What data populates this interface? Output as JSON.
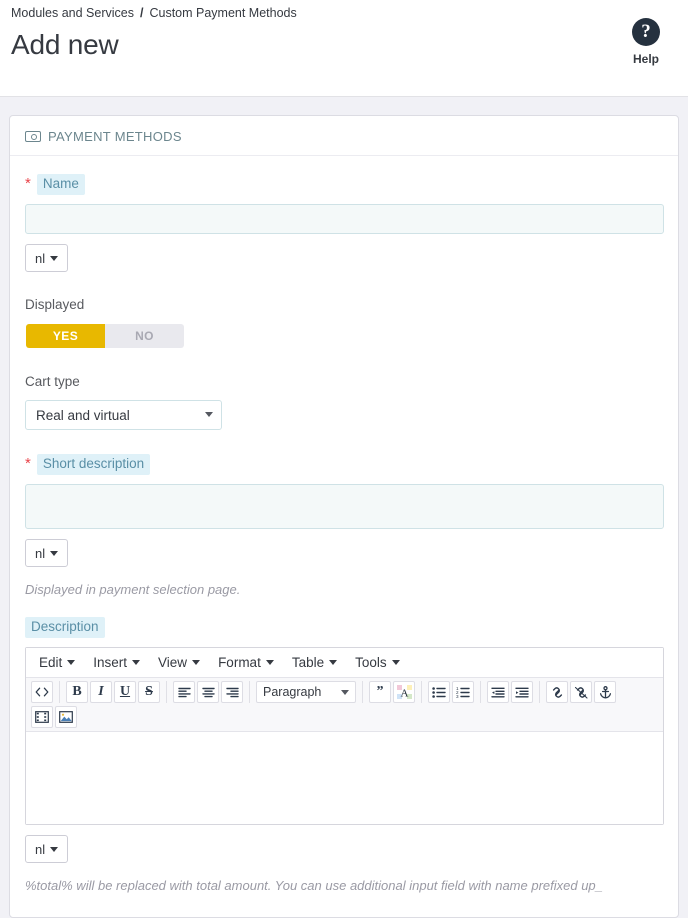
{
  "header": {
    "breadcrumb": [
      {
        "label": "Modules and Services"
      },
      {
        "label": "Custom Payment Methods"
      }
    ],
    "separator": "/",
    "title": "Add new",
    "help_label": "Help",
    "help_icon": "question-circle-icon"
  },
  "panel": {
    "icon": "money-icon",
    "heading": "PAYMENT METHODS"
  },
  "fields": {
    "name": {
      "required_marker": "*",
      "label": "Name",
      "value": "",
      "placeholder": "",
      "lang": "nl"
    },
    "displayed": {
      "label": "Displayed",
      "yes": "YES",
      "no": "NO",
      "selected": "YES"
    },
    "cart_type": {
      "label": "Cart type",
      "selected": "Real and virtual",
      "options": [
        "Real and virtual"
      ]
    },
    "short_description": {
      "required_marker": "*",
      "label": "Short description",
      "value": "",
      "placeholder": "",
      "lang": "nl",
      "hint": "Displayed in payment selection page."
    },
    "description": {
      "label": "Description",
      "value": "",
      "lang": "nl",
      "hint": "%total% will be replaced with total amount. You can use additional input field with name prefixed up_"
    }
  },
  "editor": {
    "menus": [
      {
        "label": "Edit"
      },
      {
        "label": "Insert"
      },
      {
        "label": "View"
      },
      {
        "label": "Format"
      },
      {
        "label": "Table"
      },
      {
        "label": "Tools"
      }
    ],
    "format_select": "Paragraph",
    "buttons_row1_group1": [
      {
        "name": "source-code-icon",
        "glyph": "</>"
      }
    ],
    "buttons_row1_group2": [
      {
        "name": "bold-icon",
        "glyph": "B"
      },
      {
        "name": "italic-icon",
        "glyph": "I"
      },
      {
        "name": "underline-icon",
        "glyph": "U"
      },
      {
        "name": "strikethrough-icon",
        "glyph": "S"
      }
    ],
    "buttons_row1_group3": [
      {
        "name": "align-left-icon",
        "glyph": "align-left"
      },
      {
        "name": "align-center-icon",
        "glyph": "align-center"
      },
      {
        "name": "align-right-icon",
        "glyph": "align-right"
      }
    ],
    "buttons_row1_group5": [
      {
        "name": "blockquote-icon",
        "glyph": "”"
      },
      {
        "name": "text-color-icon",
        "glyph": "A"
      }
    ],
    "buttons_row1_group6": [
      {
        "name": "bullet-list-icon",
        "glyph": "bullets"
      },
      {
        "name": "numbered-list-icon",
        "glyph": "numbers"
      }
    ],
    "buttons_row1_group7": [
      {
        "name": "outdent-icon",
        "glyph": "outdent"
      },
      {
        "name": "indent-icon",
        "glyph": "indent"
      }
    ],
    "buttons_row1_group8": [
      {
        "name": "link-icon",
        "glyph": "link"
      },
      {
        "name": "unlink-icon",
        "glyph": "unlink"
      },
      {
        "name": "anchor-icon",
        "glyph": "anchor"
      }
    ],
    "buttons_row2": [
      {
        "name": "media-icon",
        "glyph": "media"
      },
      {
        "name": "image-icon",
        "glyph": "image"
      }
    ]
  },
  "colors": {
    "accent_yellow": "#e8b800",
    "label_highlight_bg": "#dff1f8",
    "label_highlight_text": "#5a8fa6",
    "required_red": "#e9444a",
    "page_bg": "#f1f1f6",
    "input_bg": "#f4f9f9"
  }
}
